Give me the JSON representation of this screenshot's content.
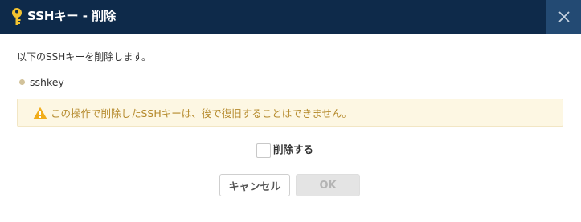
{
  "dialog": {
    "title": "SSHキー - 削除",
    "intro": "以下のSSHキーを削除します。",
    "key_name": "sshkey",
    "warning": "この操作で削除したSSHキーは、後で復旧することはできません。",
    "confirm_label": "削除する",
    "confirm_checked": false,
    "cancel_label": "キャンセル",
    "ok_label": "OK",
    "ok_enabled": false
  },
  "icons": {
    "title_icon": "key-icon",
    "close_icon": "close-icon",
    "warning_icon": "warning-icon"
  },
  "colors": {
    "header_bg": "#0e2a4a",
    "close_bg": "#234a73",
    "key_icon": "#f2c230",
    "warning_bg": "#fdf7e3",
    "warning_text": "#b58a2c",
    "warning_icon": "#f1ad1a"
  }
}
